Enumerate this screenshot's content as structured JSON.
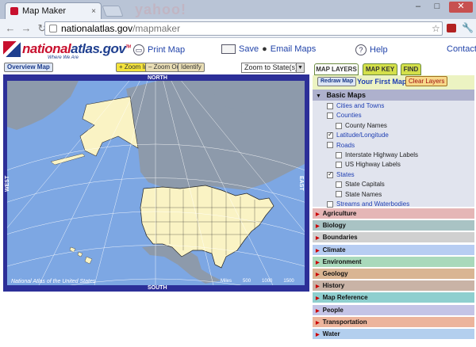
{
  "browser": {
    "tab_title": "Map Maker",
    "tab_close": "×",
    "ghost_text": "yahoo!",
    "window_controls": [
      "–",
      "□",
      "✕"
    ],
    "url_domain": "nationalatlas.gov",
    "url_path": "/mapmaker"
  },
  "header": {
    "logo_text_1": "national",
    "logo_text_2": "atlas.gov",
    "logo_tm": "TM",
    "logo_tagline": "Where We Are",
    "print_map": "Print Map",
    "save_label": "Save",
    "email_label": "Email Maps",
    "help": "Help",
    "contact": "Contact"
  },
  "toolbar": {
    "overview_map": "Overview Map",
    "zoom_in": "+ Zoom In",
    "zoom_out": "– Zoom Out",
    "identify": "Identify",
    "zoom_select": "Zoom to State(s)",
    "zoom_arrow": "▼"
  },
  "map": {
    "north": "NORTH",
    "south": "SOUTH",
    "east": "EAST",
    "west": "WEST",
    "footer_note": "National Atlas of the United States",
    "scale_labels": [
      "Miles",
      "500",
      "1000",
      "1500"
    ],
    "colors": {
      "ocean": "#7da7e3",
      "land_other": "#8d9aab",
      "land_usa": "#faf3c4",
      "frame": "#2c2f98"
    }
  },
  "panel": {
    "tabs": [
      "MAP LAYERS",
      "MAP KEY",
      "FIND"
    ],
    "redraw": "Redraw Map",
    "your_first_map": "Your First Map",
    "clear_layers": "Clear Layers",
    "basic_maps_title": "Basic Maps",
    "basic_maps_toggle": "▼",
    "layers": [
      {
        "label": "Cities and Towns",
        "checked": false,
        "indent": 0,
        "link": true
      },
      {
        "label": "Counties",
        "checked": false,
        "indent": 0,
        "link": true
      },
      {
        "label": "County Names",
        "checked": false,
        "indent": 1,
        "link": false
      },
      {
        "label": "Latitude/Longitude",
        "checked": true,
        "indent": 0,
        "link": true
      },
      {
        "label": "Roads",
        "checked": false,
        "indent": 0,
        "link": true
      },
      {
        "label": "Interstate Highway Labels",
        "checked": false,
        "indent": 1,
        "link": false
      },
      {
        "label": "US Highway Labels",
        "checked": false,
        "indent": 1,
        "link": false
      },
      {
        "label": "States",
        "checked": true,
        "indent": 0,
        "link": true
      },
      {
        "label": "State Capitals",
        "checked": false,
        "indent": 1,
        "link": false
      },
      {
        "label": "State Names",
        "checked": false,
        "indent": 1,
        "link": false
      },
      {
        "label": "Streams and Waterbodies",
        "checked": false,
        "indent": 0,
        "link": true
      }
    ],
    "categories": [
      {
        "label": "Agriculture",
        "color": "#e5b6b6"
      },
      {
        "label": "Biology",
        "color": "#a9c3c4"
      },
      {
        "label": "Boundaries",
        "color": "#d0d0d0"
      },
      {
        "label": "Climate",
        "color": "#b7cdf2"
      },
      {
        "label": "Environment",
        "color": "#a9d9bb"
      },
      {
        "label": "Geology",
        "color": "#d9b593"
      },
      {
        "label": "History",
        "color": "#c9b3a6"
      },
      {
        "label": "Map Reference",
        "color": "#8fcfcf"
      },
      {
        "label": "People",
        "color": "#c4c4e6"
      },
      {
        "label": "Transportation",
        "color": "#ecb49c"
      },
      {
        "label": "Water",
        "color": "#b3cfee"
      }
    ]
  }
}
